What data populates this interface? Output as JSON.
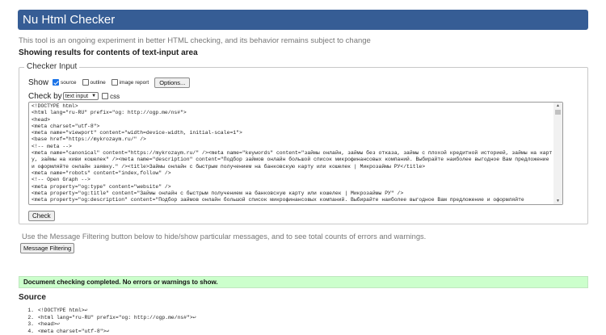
{
  "header": {
    "title": "Nu Html Checker"
  },
  "tagline": "This tool is an ongoing experiment in better HTML checking, and its behavior remains subject to change",
  "subhead": "Showing results for contents of text-input area",
  "checker": {
    "legend": "Checker Input",
    "show_label": "Show",
    "options": [
      {
        "label": "source",
        "checked": true
      },
      {
        "label": "outline",
        "checked": false
      },
      {
        "label": "image report",
        "checked": false
      }
    ],
    "options_button": "Options...",
    "checkby_label": "Check by",
    "checkby_value": "text input",
    "css_label": "css",
    "check_button": "Check",
    "textarea_text": "<!DOCTYPE html>\n<html lang=\"ru-RU\" prefix=\"og: http://ogp.me/ns#\">\n<head>\n<meta charset=\"utf-8\">\n<meta name=\"viewport\" content=\"width=device-width, initial-scale=1\">\n<base href=\"https://mykrozaym.ru/\" />\n<!-- meta -->\n<meta name=\"canonical\" content=\"https://mykrozaym.ru/\" /><meta name=\"keywords\" content=\"займы онлайн, займы без отказа, займы с плохой кредитной историей, займы на карту, займы на киви кошелек\" /><meta name=\"description\" content=\"Подбор займов онлайн большой список микрофинансовых компаний. Выбирайте наиболее выгодное Вам предложение и оформляйте онлайн заявку.\" /><title>Займы онлайн с быстрым получением на банковскую карту или кошелек | Микрозаймы РУ</title>\n<meta name=\"robots\" content=\"index,follow\" />\n<!-- Open Graph -->\n<meta property=\"og:type\" content=\"website\" />\n<meta property=\"og:title\" content=\"Займы онлайн с быстрым получением на банковскую карту или кошелек | Микрозаймы РУ\" />\n<meta property=\"og:description\" content=\"Подбор займов онлайн большой список микрофинансовых компаний. Выбирайте наиболее выгодное Вам предложение и оформляйте"
  },
  "filter": {
    "note": "Use the Message Filtering button below to hide/show particular messages, and to see total counts of errors and warnings.",
    "button": "Message Filtering"
  },
  "result": {
    "message": "Document checking completed. No errors or warnings to show."
  },
  "source": {
    "title": "Source",
    "lines": [
      {
        "num": "1.",
        "text": "<!DOCTYPE html>↩"
      },
      {
        "num": "2.",
        "text": "<html lang=\"ru-RU\" prefix=\"og: http://ogp.me/ns#\">↩"
      },
      {
        "num": "3.",
        "text": "<head>↩"
      },
      {
        "num": "4.",
        "text": "<meta charset=\"utf-8\">↩"
      }
    ]
  },
  "colors": {
    "header_bg": "#365d95",
    "success_bg": "#ccffcc"
  }
}
